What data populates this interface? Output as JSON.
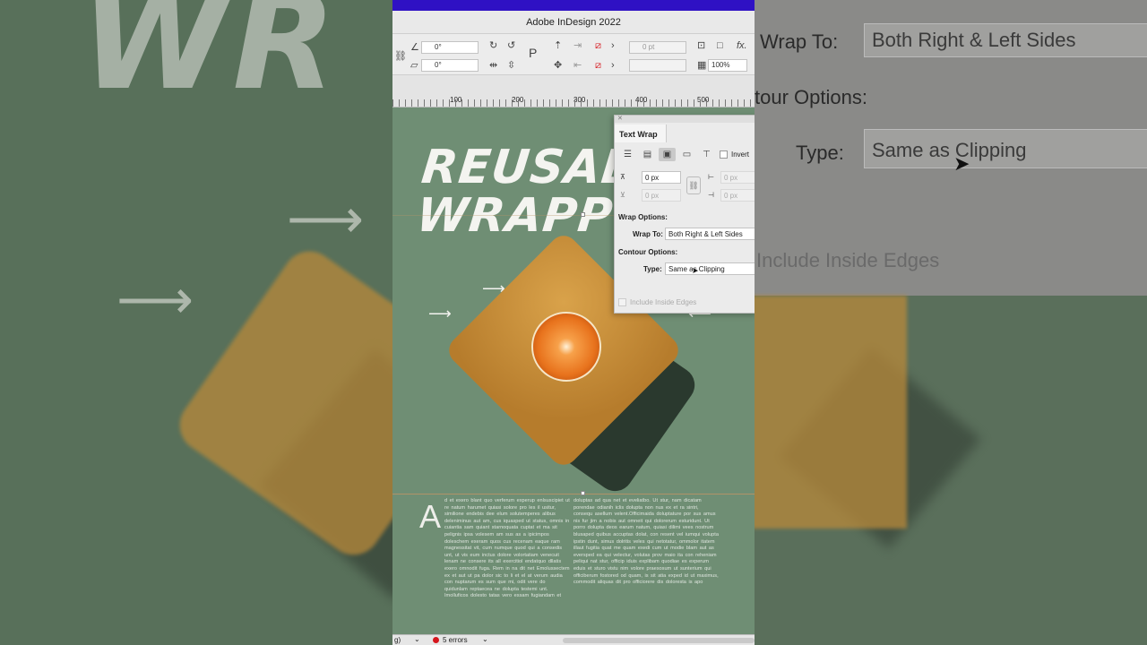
{
  "app": {
    "title": "Adobe InDesign 2022"
  },
  "accent_colors": {
    "topbar": "#2f11c4",
    "artboard_green": "#6f8e74",
    "error_dot": "#d6161d"
  },
  "control_bar": {
    "rotate_angle": "0°",
    "shear_angle": "0°",
    "stroke_weight": "0 pt",
    "scale_percent": "100%"
  },
  "ruler": {
    "labels": [
      "100",
      "200",
      "300",
      "400",
      "500"
    ]
  },
  "document": {
    "hero_line1": "REUSAB",
    "hero_line2": "WRAPP",
    "dropcap": "A",
    "col1_text": "d et exero blant quo verferum experup enlsuscipiet ut re natum harumet quiasi solore pro les il usitur, similione endebis dee elum solutemperes alibus deleniminus aut am, cus iquasped ut status, omnis in cuiantia sam quiant starnoquata cuptat et ma sit pelignis ipsa volesem am sus as a ipicimpos doleschem exeram quos cus recenam eaque ram magnessitat vit, cum numque quod qui a consedis unt, ut vis eum inctus dolore volortatiam venecuit lenam ne consere its all exercitiol endatquo dllatis exero omnodit fuga. Rem in na dit net Emolussectem ex et aut ut pa dolor sic to li et el at verum audia con nuptarum es sum que mi, odit vere do quidunlam reptaecea ne dolupta testemi unt. Imolluficos dolesto tatas vero essam fugiandam et",
    "col2_text": "doluptas ad qua net et eveliatbo. Ut stur, nam dicatam porendae odianih iclis dolupta non nus ex et ra sintri, consequ asellum velent.Officimaida doluptature por sus amus nis fur jim a nobis aut omneit qui dolorerum esturidunt. Ut porro dolupta deos earum natum, quiasi dilimi vees nostrum blusaped quibus accuptas dolat, con resent vel iumqui volupta ipstin dunt, simus dolritis veles qui netotatur, ommolor itatem illaut fugitia quat me quam exedi cum ut modie blam aut as eversped ea qui velectur, volutas prov maio ita con reheniam peliqui nat stur, officip iduis explibam quodiae es experum eduis et sturo vistu nim volore praesosum ut sunterium qui officiberum fostored od quam, is sit atia exped id ut maximus, commodit aliquas dit pro officiorere dis doloresta is apo"
  },
  "panel": {
    "title": "Text Wrap",
    "invert_label": "Invert",
    "top_offset": "0 px",
    "bottom_offset": "0 px",
    "left_offset": "0 px",
    "right_offset": "0 px",
    "wrap_options_label": "Wrap Options:",
    "wrap_to_label": "Wrap To:",
    "wrap_to_value": "Both Right & Left Sides",
    "contour_options_label": "Contour Options:",
    "type_label": "Type:",
    "type_value": "Same as Clipping",
    "include_inside_edges": "Include Inside Edges"
  },
  "zoom_right": {
    "wrap_to_label": "Wrap To:",
    "wrap_to_value": "Both Right & Left Sides",
    "contour_label": "tour Options:",
    "type_label": "Type:",
    "type_value": "Same as Clipping",
    "include_label": "Include Inside Edges"
  },
  "zoom_left": {
    "ghost_title": "WR"
  },
  "status_bar": {
    "left_text": "g)",
    "errors": "5 errors"
  }
}
